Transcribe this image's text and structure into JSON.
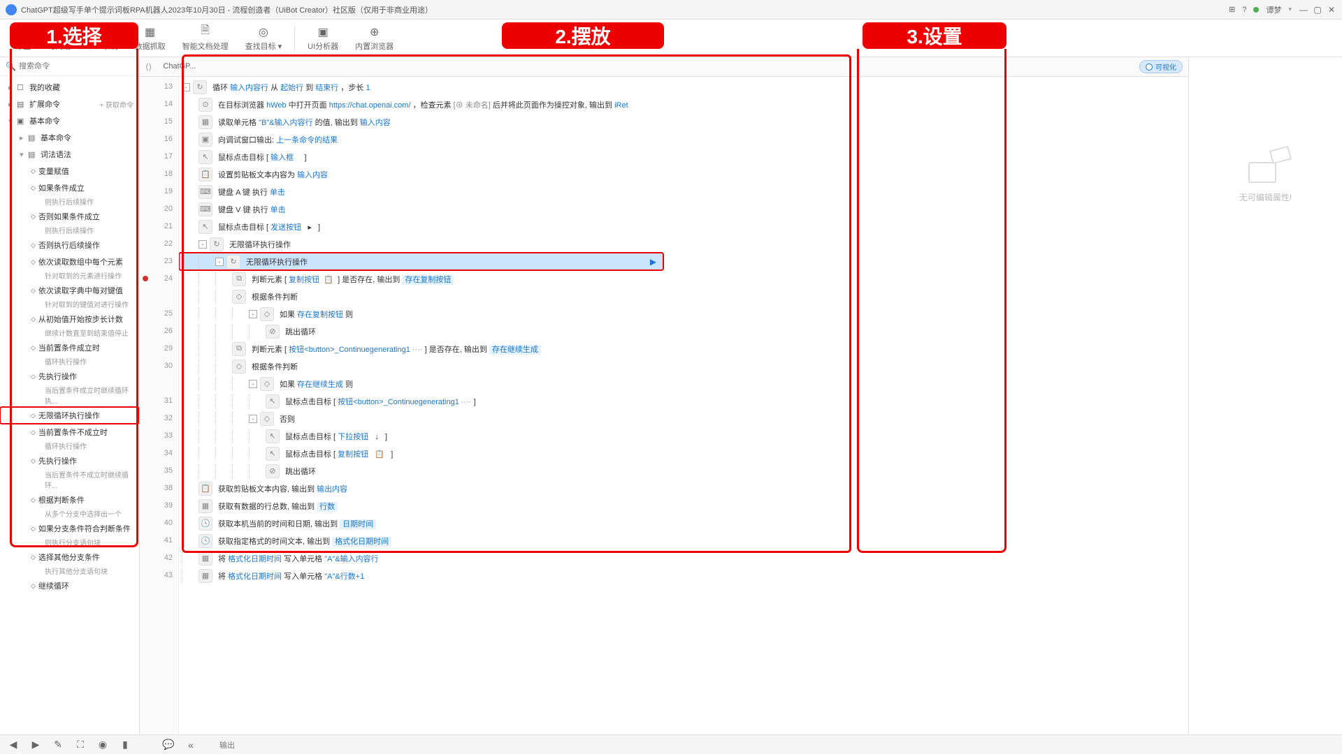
{
  "titlebar": {
    "title": "ChatGPT超级写手单个提示词板RPA机器人2023年10月30日 - 流程创造者（UiBot Creator）社区版（仅用于非商业用途）",
    "right_help": "?",
    "right_user": "谭梦",
    "grid_icon": "⊞"
  },
  "toolbar": [
    {
      "icon": "⦸",
      "label": "停止"
    },
    {
      "icon": "⧗",
      "label": "时间线",
      "dropdown": true
    },
    {
      "sep": true
    },
    {
      "icon": "◉",
      "label": "录制"
    },
    {
      "icon": "▦",
      "label": "数据抓取"
    },
    {
      "icon": "🗎",
      "label": "智能文档处理"
    },
    {
      "icon": "◎",
      "label": "查找目标",
      "dropdown": true
    },
    {
      "sep": true
    },
    {
      "icon": "▣",
      "label": "UI分析器"
    },
    {
      "icon": "⊕",
      "label": "内置浏览器"
    }
  ],
  "overlays": {
    "ov1": "1.选择",
    "ov2": "2.摆放",
    "ov3": "3.设置"
  },
  "sidebar": {
    "search_placeholder": "搜索命令",
    "tree": [
      {
        "level": 1,
        "arrow": "▸",
        "icon": "☐",
        "label": "我的收藏"
      },
      {
        "level": 1,
        "arrow": "▸",
        "icon": "▤",
        "label": "扩展命令",
        "extra": "+ 获取命令"
      },
      {
        "level": 1,
        "arrow": "▾",
        "icon": "▣",
        "label": "基本命令"
      },
      {
        "level": 2,
        "arrow": "▸",
        "icon": "▤",
        "label": "基本命令"
      },
      {
        "level": 2,
        "arrow": "▾",
        "icon": "▤",
        "label": "词法语法"
      },
      {
        "level": 3,
        "diamond": true,
        "label": "变量赋值"
      },
      {
        "level": 3,
        "diamond": true,
        "label": "如果条件成立",
        "sub": "则执行后续操作"
      },
      {
        "level": 3,
        "diamond": true,
        "label": "否则如果条件成立",
        "sub": "则执行后续操作"
      },
      {
        "level": 3,
        "diamond": true,
        "label": "否则执行后续操作"
      },
      {
        "level": 3,
        "diamond": true,
        "label": "依次读取数组中每个元素",
        "sub": "针对取到的元素进行操作"
      },
      {
        "level": 3,
        "diamond": true,
        "label": "依次读取字典中每对键值",
        "sub": "针对取到的键值对进行操作"
      },
      {
        "level": 3,
        "diamond": true,
        "label": "从初始值开始按步长计数",
        "sub": "继续计数直至到结束值停止"
      },
      {
        "level": 3,
        "diamond": true,
        "label": "当前置条件成立时",
        "sub": "循环执行操作"
      },
      {
        "level": 3,
        "diamond": true,
        "label": "先执行操作",
        "sub": "当后置条件成立时继续循环执..."
      },
      {
        "level": 3,
        "diamond": true,
        "label": "无限循环执行操作",
        "boxed": true
      },
      {
        "level": 3,
        "diamond": true,
        "label": "当前置条件不成立时",
        "sub": "循环执行操作"
      },
      {
        "level": 3,
        "diamond": true,
        "label": "先执行操作",
        "sub": "当后置条件不成立时继续循环..."
      },
      {
        "level": 3,
        "diamond": true,
        "label": "根据判断条件",
        "sub": "从多个分支中选择出一个"
      },
      {
        "level": 3,
        "diamond": true,
        "label": "如果分支条件符合判断条件",
        "sub": "则执行分支语句块"
      },
      {
        "level": 3,
        "diamond": true,
        "label": "选择其他分支条件",
        "sub": "执行其他分支语句块"
      },
      {
        "level": 3,
        "diamond": true,
        "label": "继续循环"
      }
    ]
  },
  "tabs": {
    "tab1": "ChatGP..."
  },
  "visual_toggle": "可视化",
  "code": [
    {
      "ln": 13,
      "indent": 0,
      "fold": "-",
      "icon": "↻",
      "html": "循环 <span class='tok-var'>输入内容行</span> 从 <span class='tok-var'>起始行</span> 到 <span class='tok-var'>结束行</span> ，步长 <span class='tok-num'>1</span>"
    },
    {
      "ln": 14,
      "indent": 1,
      "icon": "⊙",
      "html": "在目标浏览器 <span class='tok-var'>hWeb</span> 中打开页面 <span class='tok-str'>https://chat.openai.com/</span> ，检查元素 <span class='tok-comment'>[⊕ 未命名]</span> 后并将此页面作为操控对象, 输出到 <span class='tok-var'>iRet</span>"
    },
    {
      "ln": 15,
      "indent": 1,
      "icon": "▦",
      "html": "读取单元格 <span class='tok-str'>\"B\"&输入内容行</span> 的值, 输出到 <span class='tok-var'>输入内容</span>"
    },
    {
      "ln": 16,
      "indent": 1,
      "icon": "▣",
      "html": "向调试窗口输出: <span class='tok-var'>上一条命令的结果</span>"
    },
    {
      "ln": 17,
      "indent": 1,
      "icon": "↖",
      "html": "鼠标点击目标 [ <span class='tok-var'>输入框</span> &nbsp;&nbsp;&nbsp; ]"
    },
    {
      "ln": 18,
      "indent": 1,
      "icon": "📋",
      "html": "设置剪贴板文本内容为 <span class='tok-var'>输入内容</span>"
    },
    {
      "ln": 19,
      "indent": 1,
      "icon": "⌨",
      "html": "键盘 <span class='tok-kw'>A</span> 键 执行 <span class='tok-var'>单击</span>"
    },
    {
      "ln": 20,
      "indent": 1,
      "icon": "⌨",
      "html": "键盘 <span class='tok-kw'>V</span> 键 执行 <span class='tok-var'>单击</span>"
    },
    {
      "ln": 21,
      "indent": 1,
      "icon": "↖",
      "html": "鼠标点击目标 [ <span class='tok-var'>发送按钮</span> &nbsp; ▸ &nbsp; ]"
    },
    {
      "ln": 22,
      "indent": 1,
      "fold": "-",
      "icon": "↻",
      "html": "无限循环执行操作"
    },
    {
      "ln": 23,
      "indent": 2,
      "fold": "-",
      "icon": "↻",
      "html": "无限循环执行操作",
      "selected": true,
      "boxed": true,
      "play": true
    },
    {
      "ln": 24,
      "indent": 3,
      "icon": "⧉",
      "bp": true,
      "html": "判断元素 [ <span class='tok-var'>复制按钮</span> &nbsp;📋&nbsp; ] 是否存在, 输出到 <span class='tok-var tok-highlight'>存在复制按钮</span>"
    },
    {
      "ln": "",
      "indent": 3,
      "icon": "◇",
      "html": "根据条件判断"
    },
    {
      "ln": 25,
      "indent": 4,
      "fold": "-",
      "icon": "◇",
      "html": "如果 <span class='tok-var'>存在复制按钮</span> 则"
    },
    {
      "ln": 26,
      "indent": 5,
      "icon": "⊘",
      "html": "跳出循环"
    },
    {
      "ln": 29,
      "indent": 3,
      "icon": "⧉",
      "html": "判断元素 [ <span class='tok-var'>按钮&lt;button&gt;_Continuegenerating1</span> <span class='tok-comment'>····</span> ] 是否存在, 输出到 <span class='tok-var tok-highlight'>存在继续生成</span>"
    },
    {
      "ln": 30,
      "indent": 3,
      "icon": "◇",
      "html": "根据条件判断"
    },
    {
      "ln": "",
      "indent": 4,
      "fold": "-",
      "icon": "◇",
      "html": "如果 <span class='tok-var'>存在继续生成</span> 则"
    },
    {
      "ln": 31,
      "indent": 5,
      "icon": "↖",
      "html": "鼠标点击目标 [ <span class='tok-var'>按钮&lt;button&gt;_Continuegenerating1</span> <span class='tok-comment'>····</span> ]"
    },
    {
      "ln": 32,
      "indent": 4,
      "fold": "-",
      "icon": "◇",
      "html": "否则"
    },
    {
      "ln": 33,
      "indent": 5,
      "icon": "↖",
      "html": "鼠标点击目标 [ <span class='tok-var'>下拉按钮</span> &nbsp; ↓ &nbsp; ]"
    },
    {
      "ln": 34,
      "indent": 5,
      "icon": "↖",
      "html": "鼠标点击目标 [ <span class='tok-var'>复制按钮</span> &nbsp; 📋 &nbsp; ]"
    },
    {
      "ln": 35,
      "indent": 5,
      "icon": "⊘",
      "html": "跳出循环"
    },
    {
      "ln": 38,
      "indent": 1,
      "icon": "📋",
      "html": "获取剪贴板文本内容, 输出到 <span class='tok-var'>输出内容</span>"
    },
    {
      "ln": 39,
      "indent": 1,
      "icon": "▦",
      "html": "获取有数据的行总数, 输出到 <span class='tok-var tok-highlight'>行数</span>"
    },
    {
      "ln": 40,
      "indent": 1,
      "icon": "🕓",
      "html": "获取本机当前的时间和日期, 输出到 <span class='tok-var tok-highlight'>日期时间</span>"
    },
    {
      "ln": 41,
      "indent": 1,
      "icon": "🕓",
      "html": "获取指定格式的时间文本, 输出到 <span class='tok-var tok-highlight'>格式化日期时间</span>"
    },
    {
      "ln": 42,
      "indent": 1,
      "icon": "▦",
      "html": "将 <span class='tok-var'>格式化日期时间</span> 写入单元格 <span class='tok-str'>\"A\"&输入内容行</span>"
    },
    {
      "ln": 43,
      "indent": 1,
      "icon": "▦",
      "html": "将 <span class='tok-var'>格式化日期时间</span> 写入单元格 <span class='tok-str'>\"A\"&行数+1</span>"
    }
  ],
  "props": {
    "empty": "无可编辑属性!"
  },
  "bottom": {
    "output": "输出"
  }
}
